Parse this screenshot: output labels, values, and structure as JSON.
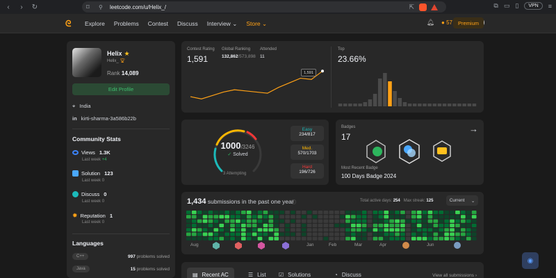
{
  "browser": {
    "url": "leetcode.com/u/Helix_/",
    "vpn": "VPN"
  },
  "nav": {
    "links": [
      "Explore",
      "Problems",
      "Contest",
      "Discuss",
      "Interview",
      "Store"
    ],
    "streak": "57",
    "premium": "Premium"
  },
  "profile": {
    "name": "Helix",
    "handle": "Helix_",
    "rank_label": "Rank",
    "rank": "14,089",
    "edit": "Edit Profile",
    "location": "India",
    "linkedin": "kirti-sharma-3a586b22b"
  },
  "community": {
    "title": "Community Stats",
    "items": [
      {
        "label": "Views",
        "value": "1.3K",
        "sub": "Last week",
        "delta": "+4"
      },
      {
        "label": "Solution",
        "value": "123",
        "sub": "Last week",
        "delta": "0"
      },
      {
        "label": "Discuss",
        "value": "0",
        "sub": "Last week",
        "delta": "0"
      },
      {
        "label": "Reputation",
        "value": "1",
        "sub": "Last week",
        "delta": "0"
      }
    ]
  },
  "languages": {
    "title": "Languages",
    "items": [
      {
        "name": "C++",
        "count": "997",
        "suffix": "problems solved"
      },
      {
        "name": "Java",
        "count": "15",
        "suffix": "problems solved"
      }
    ]
  },
  "contest": {
    "rating_label": "Contest Rating",
    "rating": "1,591",
    "global_label": "Global Ranking",
    "global_rank": "132,862",
    "global_total": "/573,898",
    "attended_label": "Attended",
    "attended": "11",
    "tooltip": "1,591",
    "top_label": "Top",
    "top": "23.66%",
    "rating_series": [
      1480,
      1470,
      1485,
      1500,
      1510,
      1505,
      1500,
      1495,
      1520,
      1540,
      1560,
      1555,
      1591
    ],
    "histogram": [
      4,
      4,
      4,
      4,
      4,
      6,
      10,
      18,
      40,
      48,
      36,
      22,
      12,
      6,
      4,
      4,
      4,
      4,
      4,
      4,
      4,
      4,
      4,
      4,
      4,
      4,
      4,
      4
    ],
    "highlight_bar": 10
  },
  "solved": {
    "count": "1000",
    "total": "/3246",
    "label": "Solved",
    "attempting": "3 Attempting",
    "easy_label": "Easy",
    "easy": "234/817",
    "medium_label": "Med.",
    "medium": "570/1703",
    "hard_label": "Hard",
    "hard": "196/726"
  },
  "badges": {
    "label": "Badges",
    "count": "17",
    "recent_label": "Most Recent Badge",
    "recent": "100 Days Badge 2024"
  },
  "submissions": {
    "count": "1,434",
    "text": "submissions in the past one year",
    "active_label": "Total active days:",
    "active": "254",
    "streak_label": "Max streak:",
    "streak": "125",
    "period": "Current",
    "months": [
      "Aug",
      "",
      "",
      "",
      "",
      "Jan",
      "Feb",
      "Mar",
      "Apr",
      "",
      "Jun",
      ""
    ]
  },
  "tabs": {
    "items": [
      "Recent AC",
      "List",
      "Solutions",
      "Discuss"
    ],
    "view_all": "View all submissions"
  },
  "colors": {
    "accent": "#ffa116",
    "easy": "#1cbaba",
    "medium": "#ffb700",
    "hard": "#f63737",
    "green": "#2db55d"
  }
}
